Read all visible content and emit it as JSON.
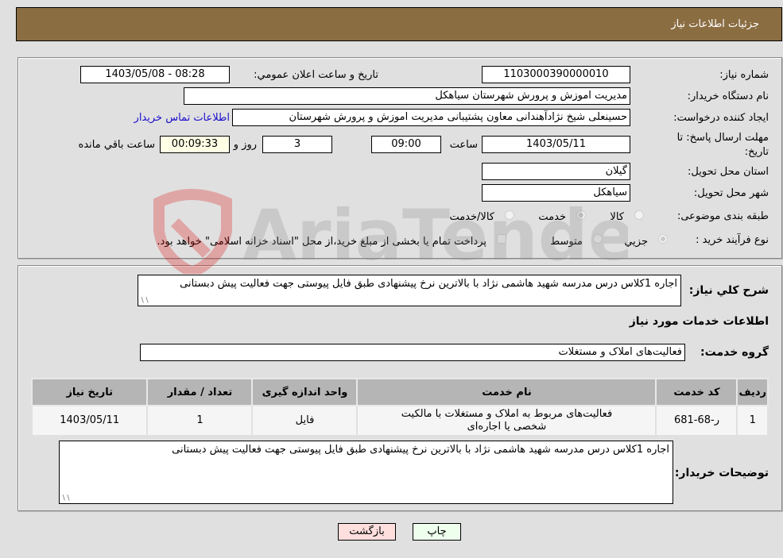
{
  "header": {
    "title": "جزئیات اطلاعات نیاز"
  },
  "form": {
    "need_number": {
      "label": "شماره نیاز:",
      "value": "1103000390000010"
    },
    "announce_datetime": {
      "label": "تاریخ و ساعت اعلان عمومي:",
      "value": "1403/05/08 - 08:28"
    },
    "buyer_org": {
      "label": "نام دستگاه خریدار:",
      "value": "مدیریت اموزش و پرورش شهرستان سیاهکل"
    },
    "requester": {
      "label": "ایجاد کننده درخواست:",
      "value": "حسینعلی شیخ نژادآهندانی معاون پشتیبانی مدیریت اموزش و پرورش شهرستان",
      "contact_link": "اطلاعات تماس خریدار"
    },
    "deadline": {
      "label": "مهلت ارسال پاسخ: تا تاریخ:",
      "date": "1403/05/11",
      "time_label": "ساعت",
      "time": "09:00",
      "days": "3",
      "days_label": "روز و",
      "remaining": "00:09:33",
      "remaining_label": "ساعت باقي مانده"
    },
    "province": {
      "label": "استان محل تحویل:",
      "value": "گیلان"
    },
    "city": {
      "label": "شهر محل تحویل:",
      "value": "سیاهکل"
    },
    "category": {
      "label": "طبقه بندی موضوعی:",
      "options": [
        "کالا",
        "خدمت",
        "کالا/خدمت"
      ],
      "selected": "خدمت"
    },
    "purchase_type": {
      "label": "نوع فرآیند خرید :",
      "options": [
        "جزیي",
        "متوسط"
      ],
      "selected": "جزیي",
      "treasury_note": "پرداخت تمام یا بخشی از مبلغ خرید،از محل \"اسناد خزانه اسلامی\" خواهد بود."
    }
  },
  "summary": {
    "label": "شرح کلي نیاز:",
    "value": "اجاره 1کلاس درس مدرسه شهید هاشمی نژاد با بالاترین نرخ پیشنهادی طبق فایل پیوستی جهت فعالیت پیش دبستانی"
  },
  "services_section": {
    "title": "اطلاعات خدمات مورد نیاز",
    "group_label": "گروه خدمت:",
    "group_value": "فعالیت‌های  املاک و مستغلات"
  },
  "table": {
    "headers": [
      "ردیف",
      "کد خدمت",
      "نام خدمت",
      "واحد اندازه گیری",
      "تعداد / مقدار",
      "تاریخ نیاز"
    ],
    "rows": [
      {
        "row": "1",
        "code": "ر-68-681",
        "name": "فعالیت‌های مربوط به املاک و مستغلات با مالکیت شخصی یا اجاره‌ای",
        "unit": "فایل",
        "quantity": "1",
        "date": "1403/05/11"
      }
    ]
  },
  "buyer_notes": {
    "label": "توضیحات خریدار:",
    "value": "اجاره 1کلاس درس مدرسه شهید هاشمی نژاد با بالاترین نرخ پیشنهادی طبق فایل پیوستی جهت فعالیت پیش دبستانی"
  },
  "buttons": {
    "print": "چاپ",
    "back": "بازگشت"
  },
  "watermark": {
    "text": "AriaTender.neT"
  }
}
